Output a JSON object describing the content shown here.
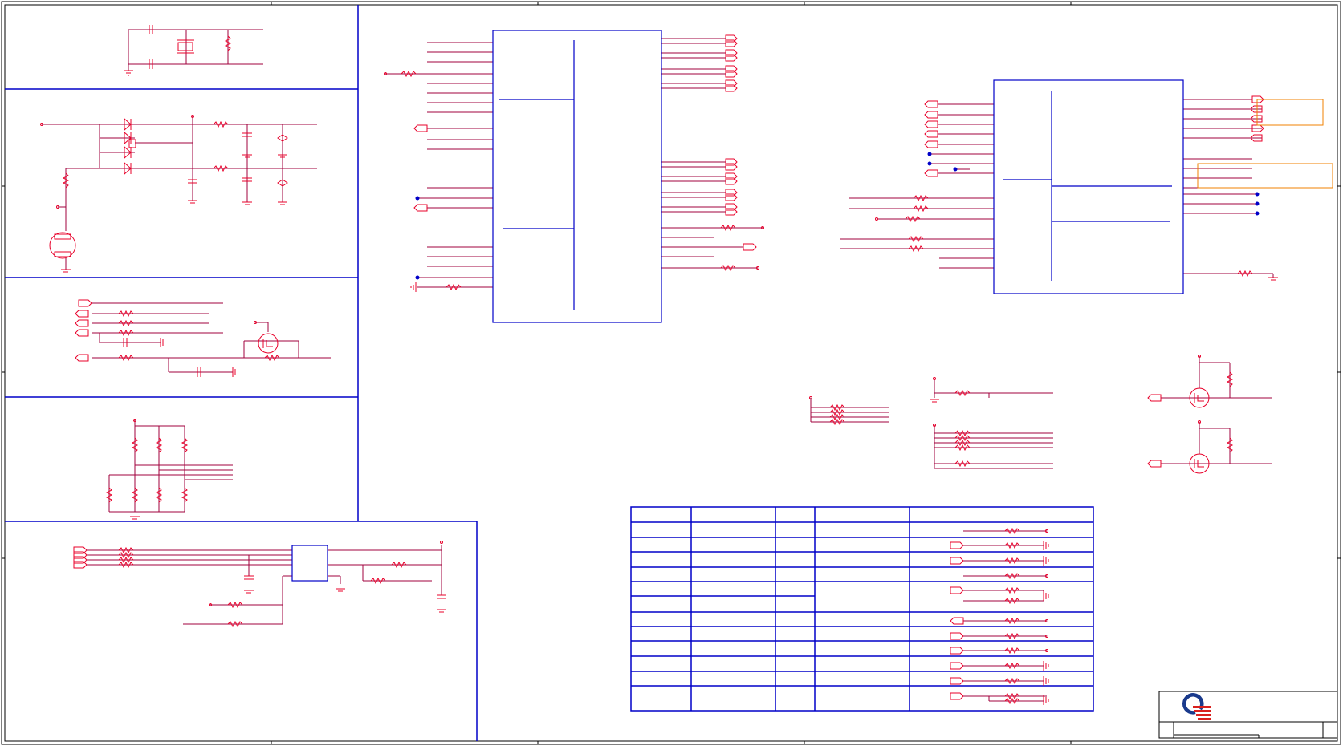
{
  "sheet": {
    "title_block": {
      "logo": "quanta-logo"
    },
    "colors": {
      "wire": "#a0003c",
      "symbol": "#e8002a",
      "box": "#0000c8",
      "border": "#000000",
      "highlight": "#f08000",
      "junction": "#0000c8",
      "logo_blue": "#1a3a8c",
      "logo_red": "#d9201e"
    }
  }
}
